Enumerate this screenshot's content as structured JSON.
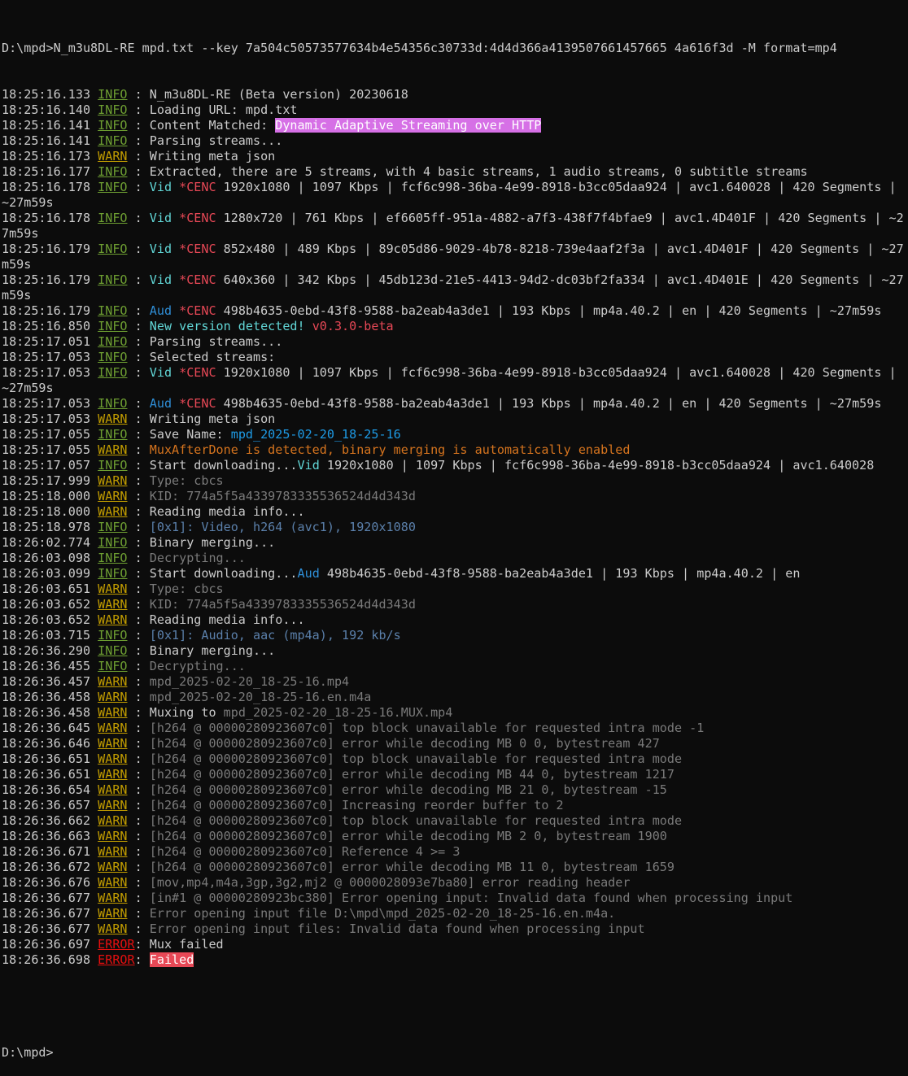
{
  "window": {
    "command": "D:\\mpd>N_m3u8DL-RE mpd.txt --key 7a504c50573577634b4e54356c30733d:4d4d366a4139507661457665 4a616f3d -M format=mp4",
    "prompt": "D:\\mpd>"
  },
  "colors": {
    "background": "#0c0c0c",
    "text": "#cccccc",
    "info": "#6e9f32",
    "warn": "#c19c00",
    "error": "#e60f0f"
  },
  "lines": [
    {
      "ts": "18:25:16.133",
      "level": "INFO",
      "sep": " : ",
      "segs": [
        {
          "t": "N_m3u8DL-RE (Beta version) 20230618"
        }
      ]
    },
    {
      "ts": "18:25:16.140",
      "level": "INFO",
      "sep": " : ",
      "segs": [
        {
          "t": "Loading URL: mpd.txt"
        }
      ]
    },
    {
      "ts": "18:25:16.141",
      "level": "INFO",
      "sep": " : ",
      "segs": [
        {
          "t": "Content Matched: "
        },
        {
          "t": "Dynamic Adaptive Streaming over HTTP",
          "c": "hl"
        }
      ]
    },
    {
      "ts": "18:25:16.141",
      "level": "INFO",
      "sep": " : ",
      "segs": [
        {
          "t": "Parsing streams..."
        }
      ]
    },
    {
      "ts": "18:25:16.173",
      "level": "WARN",
      "sep": " : ",
      "segs": [
        {
          "t": "Writing meta json"
        }
      ]
    },
    {
      "ts": "18:25:16.177",
      "level": "INFO",
      "sep": " : ",
      "segs": [
        {
          "t": "Extracted, there are 5 streams, with 4 basic streams, 1 audio streams, 0 subtitle streams"
        }
      ]
    },
    {
      "ts": "18:25:16.178",
      "level": "INFO",
      "sep": " : ",
      "segs": [
        {
          "t": "Vid ",
          "c": "cyan"
        },
        {
          "t": "*CENC ",
          "c": "red"
        },
        {
          "t": "1920x1080 | 1097 Kbps | fcf6c998-36ba-4e99-8918-b3cc05daa924 | avc1.640028 | 420 Segments | ~27m59s"
        }
      ]
    },
    {
      "ts": "18:25:16.178",
      "level": "INFO",
      "sep": " : ",
      "segs": [
        {
          "t": "Vid ",
          "c": "cyan"
        },
        {
          "t": "*CENC ",
          "c": "red"
        },
        {
          "t": "1280x720 | 761 Kbps | ef6605ff-951a-4882-a7f3-438f7f4bfae9 | avc1.4D401F | 420 Segments | ~27m59s"
        }
      ]
    },
    {
      "ts": "18:25:16.179",
      "level": "INFO",
      "sep": " : ",
      "segs": [
        {
          "t": "Vid ",
          "c": "cyan"
        },
        {
          "t": "*CENC ",
          "c": "red"
        },
        {
          "t": "852x480 | 489 Kbps | 89c05d86-9029-4b78-8218-739e4aaf2f3a | avc1.4D401F | 420 Segments | ~27m59s"
        }
      ]
    },
    {
      "ts": "18:25:16.179",
      "level": "INFO",
      "sep": " : ",
      "segs": [
        {
          "t": "Vid ",
          "c": "cyan"
        },
        {
          "t": "*CENC ",
          "c": "red"
        },
        {
          "t": "640x360 | 342 Kbps | 45db123d-21e5-4413-94d2-dc03bf2fa334 | avc1.4D401E | 420 Segments | ~27m59s"
        }
      ]
    },
    {
      "ts": "18:25:16.179",
      "level": "INFO",
      "sep": " : ",
      "segs": [
        {
          "t": "Aud ",
          "c": "blue"
        },
        {
          "t": "*CENC ",
          "c": "red"
        },
        {
          "t": "498b4635-0ebd-43f8-9588-ba2eab4a3de1 | 193 Kbps | mp4a.40.2 | en | 420 Segments | ~27m59s"
        }
      ]
    },
    {
      "ts": "18:25:16.850",
      "level": "INFO",
      "sep": " : ",
      "segs": [
        {
          "t": "New version detected! ",
          "c": "cyan"
        },
        {
          "t": "v0.3.0-beta",
          "c": "red"
        }
      ]
    },
    {
      "ts": "18:25:17.051",
      "level": "INFO",
      "sep": " : ",
      "segs": [
        {
          "t": "Parsing streams..."
        }
      ]
    },
    {
      "ts": "18:25:17.053",
      "level": "INFO",
      "sep": " : ",
      "segs": [
        {
          "t": "Selected streams:"
        }
      ]
    },
    {
      "ts": "18:25:17.053",
      "level": "INFO",
      "sep": " : ",
      "segs": [
        {
          "t": "Vid ",
          "c": "cyan"
        },
        {
          "t": "*CENC ",
          "c": "red"
        },
        {
          "t": "1920x1080 | 1097 Kbps | fcf6c998-36ba-4e99-8918-b3cc05daa924 | avc1.640028 | 420 Segments | ~27m59s"
        }
      ]
    },
    {
      "ts": "18:25:17.053",
      "level": "INFO",
      "sep": " : ",
      "segs": [
        {
          "t": "Aud ",
          "c": "blue"
        },
        {
          "t": "*CENC ",
          "c": "red"
        },
        {
          "t": "498b4635-0ebd-43f8-9588-ba2eab4a3de1 | 193 Kbps | mp4a.40.2 | en | 420 Segments | ~27m59s"
        }
      ]
    },
    {
      "ts": "18:25:17.053",
      "level": "WARN",
      "sep": " : ",
      "segs": [
        {
          "t": "Writing meta json"
        }
      ]
    },
    {
      "ts": "18:25:17.055",
      "level": "INFO",
      "sep": " : ",
      "segs": [
        {
          "t": "Save Name: "
        },
        {
          "t": "mpd_2025-02-20_18-25-16",
          "c": "link"
        }
      ]
    },
    {
      "ts": "18:25:17.055",
      "level": "WARN",
      "sep": " : ",
      "segs": [
        {
          "t": "MuxAfterDone is detected, binary merging is automatically enabled",
          "c": "orange"
        }
      ]
    },
    {
      "ts": "18:25:17.057",
      "level": "INFO",
      "sep": " : ",
      "segs": [
        {
          "t": "Start downloading..."
        },
        {
          "t": "Vid",
          "c": "cyan"
        },
        {
          "t": " 1920x1080 | 1097 Kbps | fcf6c998-36ba-4e99-8918-b3cc05daa924 | avc1.640028"
        }
      ]
    },
    {
      "ts": "18:25:17.999",
      "level": "WARN",
      "sep": " : ",
      "segs": [
        {
          "t": "Type: cbcs",
          "c": "dim"
        }
      ]
    },
    {
      "ts": "18:25:18.000",
      "level": "WARN",
      "sep": " : ",
      "segs": [
        {
          "t": "KID: 774a5f5a4339783335536524d4d343d",
          "c": "dim"
        }
      ]
    },
    {
      "ts": "18:25:18.000",
      "level": "WARN",
      "sep": " : ",
      "segs": [
        {
          "t": "Reading media info..."
        }
      ]
    },
    {
      "ts": "18:25:18.978",
      "level": "INFO",
      "sep": " : ",
      "segs": [
        {
          "t": "[0x1]: Video, h264 (avc1), 1920x1080",
          "c": "media"
        }
      ]
    },
    {
      "ts": "18:26:02.774",
      "level": "INFO",
      "sep": " : ",
      "segs": [
        {
          "t": "Binary merging..."
        }
      ]
    },
    {
      "ts": "18:26:03.098",
      "level": "INFO",
      "sep": " : ",
      "segs": [
        {
          "t": "Decrypting...",
          "c": "dim"
        }
      ]
    },
    {
      "ts": "18:26:03.099",
      "level": "INFO",
      "sep": " : ",
      "segs": [
        {
          "t": "Start downloading..."
        },
        {
          "t": "Aud",
          "c": "blue"
        },
        {
          "t": " 498b4635-0ebd-43f8-9588-ba2eab4a3de1 | 193 Kbps | mp4a.40.2 | en"
        }
      ]
    },
    {
      "ts": "18:26:03.651",
      "level": "WARN",
      "sep": " : ",
      "segs": [
        {
          "t": "Type: cbcs",
          "c": "dim"
        }
      ]
    },
    {
      "ts": "18:26:03.652",
      "level": "WARN",
      "sep": " : ",
      "segs": [
        {
          "t": "KID: 774a5f5a4339783335536524d4d343d",
          "c": "dim"
        }
      ]
    },
    {
      "ts": "18:26:03.652",
      "level": "WARN",
      "sep": " : ",
      "segs": [
        {
          "t": "Reading media info..."
        }
      ]
    },
    {
      "ts": "18:26:03.715",
      "level": "INFO",
      "sep": " : ",
      "segs": [
        {
          "t": "[0x1]: Audio, aac (mp4a), 192 kb/s",
          "c": "media"
        }
      ]
    },
    {
      "ts": "18:26:36.290",
      "level": "INFO",
      "sep": " : ",
      "segs": [
        {
          "t": "Binary merging..."
        }
      ]
    },
    {
      "ts": "18:26:36.455",
      "level": "INFO",
      "sep": " : ",
      "segs": [
        {
          "t": "Decrypting...",
          "c": "dim"
        }
      ]
    },
    {
      "ts": "18:26:36.457",
      "level": "WARN",
      "sep": " : ",
      "segs": [
        {
          "t": "mpd_2025-02-20_18-25-16.mp4",
          "c": "dim"
        }
      ]
    },
    {
      "ts": "18:26:36.458",
      "level": "WARN",
      "sep": " : ",
      "segs": [
        {
          "t": "mpd_2025-02-20_18-25-16.en.m4a",
          "c": "dim"
        }
      ]
    },
    {
      "ts": "18:26:36.458",
      "level": "WARN",
      "sep": " : ",
      "segs": [
        {
          "t": "Muxing to "
        },
        {
          "t": "mpd_2025-02-20_18-25-16.MUX.mp4",
          "c": "dim"
        }
      ]
    },
    {
      "ts": "18:26:36.645",
      "level": "WARN",
      "sep": " : ",
      "segs": [
        {
          "t": "[h264 @ 00000280923607c0] top block unavailable for requested intra mode -1",
          "c": "dim"
        }
      ]
    },
    {
      "ts": "18:26:36.646",
      "level": "WARN",
      "sep": " : ",
      "segs": [
        {
          "t": "[h264 @ 00000280923607c0] error while decoding MB 0 0, bytestream 427",
          "c": "dim"
        }
      ]
    },
    {
      "ts": "18:26:36.651",
      "level": "WARN",
      "sep": " : ",
      "segs": [
        {
          "t": "[h264 @ 00000280923607c0] top block unavailable for requested intra mode",
          "c": "dim"
        }
      ]
    },
    {
      "ts": "18:26:36.651",
      "level": "WARN",
      "sep": " : ",
      "segs": [
        {
          "t": "[h264 @ 00000280923607c0] error while decoding MB 44 0, bytestream 1217",
          "c": "dim"
        }
      ]
    },
    {
      "ts": "18:26:36.654",
      "level": "WARN",
      "sep": " : ",
      "segs": [
        {
          "t": "[h264 @ 00000280923607c0] error while decoding MB 21 0, bytestream -15",
          "c": "dim"
        }
      ]
    },
    {
      "ts": "18:26:36.657",
      "level": "WARN",
      "sep": " : ",
      "segs": [
        {
          "t": "[h264 @ 00000280923607c0] Increasing reorder buffer to 2",
          "c": "dim"
        }
      ]
    },
    {
      "ts": "18:26:36.662",
      "level": "WARN",
      "sep": " : ",
      "segs": [
        {
          "t": "[h264 @ 00000280923607c0] top block unavailable for requested intra mode",
          "c": "dim"
        }
      ]
    },
    {
      "ts": "18:26:36.663",
      "level": "WARN",
      "sep": " : ",
      "segs": [
        {
          "t": "[h264 @ 00000280923607c0] error while decoding MB 2 0, bytestream 1900",
          "c": "dim"
        }
      ]
    },
    {
      "ts": "18:26:36.671",
      "level": "WARN",
      "sep": " : ",
      "segs": [
        {
          "t": "[h264 @ 00000280923607c0] Reference 4 >= 3",
          "c": "dim"
        }
      ]
    },
    {
      "ts": "18:26:36.672",
      "level": "WARN",
      "sep": " : ",
      "segs": [
        {
          "t": "[h264 @ 00000280923607c0] error while decoding MB 11 0, bytestream 1659",
          "c": "dim"
        }
      ]
    },
    {
      "ts": "18:26:36.676",
      "level": "WARN",
      "sep": " : ",
      "segs": [
        {
          "t": "[mov,mp4,m4a,3gp,3g2,mj2 @ 0000028093e7ba80] error reading header",
          "c": "dim"
        }
      ]
    },
    {
      "ts": "18:26:36.677",
      "level": "WARN",
      "sep": " : ",
      "segs": [
        {
          "t": "[in#1 @ 00000280923bc380] Error opening input: Invalid data found when processing input",
          "c": "dim"
        }
      ]
    },
    {
      "ts": "18:26:36.677",
      "level": "WARN",
      "sep": " : ",
      "segs": [
        {
          "t": "Error opening input file D:\\mpd\\mpd_2025-02-20_18-25-16.en.m4a.",
          "c": "dim"
        }
      ]
    },
    {
      "ts": "18:26:36.677",
      "level": "WARN",
      "sep": " : ",
      "segs": [
        {
          "t": "Error opening input files: Invalid data found when processing input",
          "c": "dim"
        }
      ]
    },
    {
      "ts": "18:26:36.697",
      "level": "ERROR",
      "sep": ": ",
      "segs": [
        {
          "t": "Mux failed"
        }
      ]
    },
    {
      "ts": "18:26:36.698",
      "level": "ERROR",
      "sep": ": ",
      "segs": [
        {
          "t": "Failed",
          "c": "fail"
        }
      ]
    }
  ]
}
